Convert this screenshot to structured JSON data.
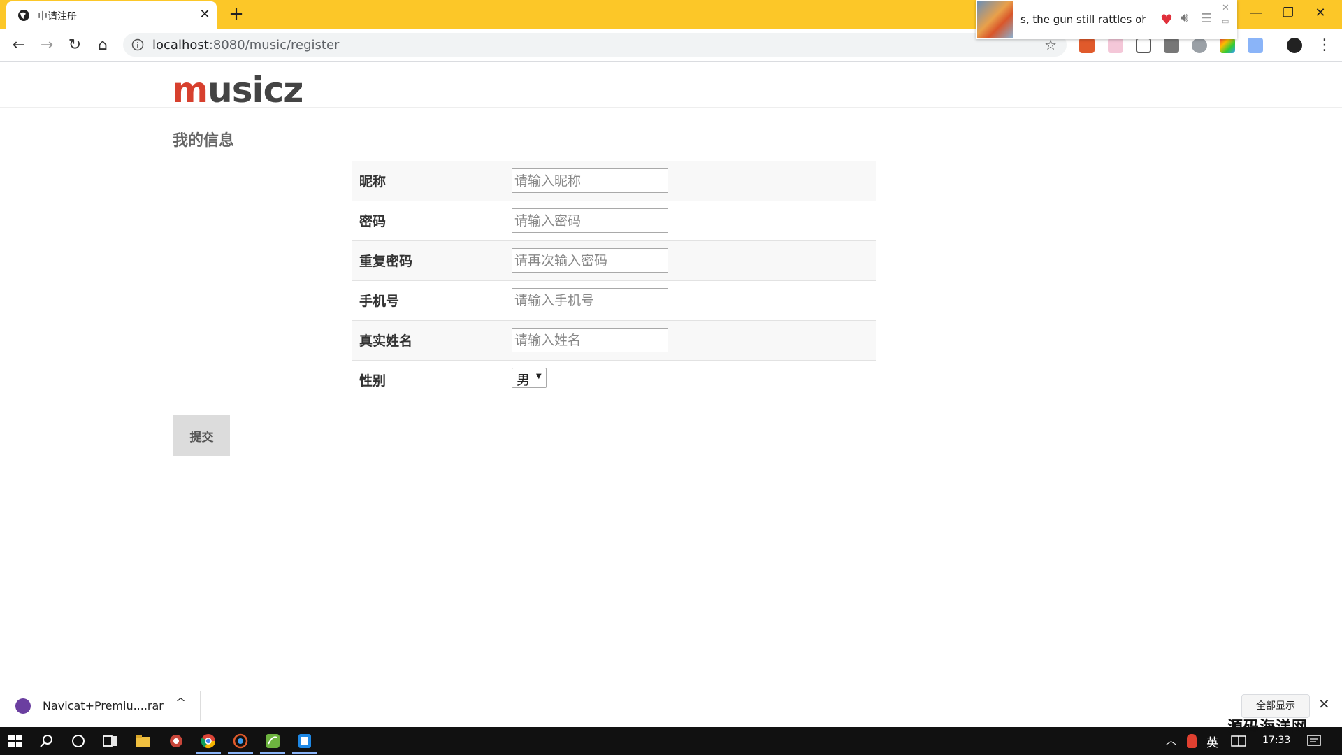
{
  "browser": {
    "tab_title": "申请注册",
    "url_host": "localhost",
    "url_path": ":8080/music/register"
  },
  "player": {
    "song_title": "s, the gun still rattles ohh"
  },
  "site": {
    "logo_m": "m",
    "logo_rest": "usicz"
  },
  "section": {
    "title": "我的信息"
  },
  "form": {
    "nickname_label": "昵称",
    "nickname_placeholder": "请输入昵称",
    "password_label": "密码",
    "password_placeholder": "请输入密码",
    "repeat_password_label": "重复密码",
    "repeat_password_placeholder": "请再次输入密码",
    "phone_label": "手机号",
    "phone_placeholder": "请输入手机号",
    "realname_label": "真实姓名",
    "realname_placeholder": "请输入姓名",
    "gender_label": "性别",
    "gender_value": "男",
    "submit_label": "提交"
  },
  "download_bar": {
    "file_name": "Navicat+Premiu....rar",
    "show_all": "全部显示"
  },
  "taskbar": {
    "ime": "英",
    "clock": "17:33"
  },
  "watermark": "源码海洋网",
  "colors": {
    "tabbar": "#fcc728",
    "logo_red": "#d7402e",
    "logo_dark": "#444444",
    "taskbar": "#111111"
  }
}
